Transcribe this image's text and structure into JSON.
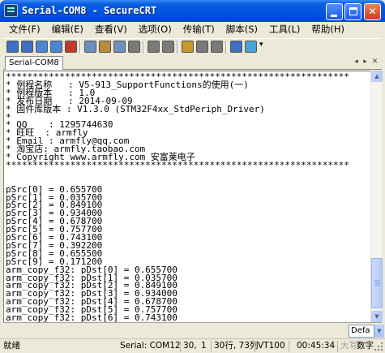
{
  "window": {
    "title": "Serial-COM8 - SecureCRT",
    "minimize_icon": "minimize-icon",
    "maximize_icon": "maximize-icon",
    "close_glyph": "✕"
  },
  "menu": [
    {
      "label": "文件(F)"
    },
    {
      "label": "编辑(E)"
    },
    {
      "label": "查看(V)"
    },
    {
      "label": "选项(O)"
    },
    {
      "label": "传输(T)"
    },
    {
      "label": "脚本(S)"
    },
    {
      "label": "工具(L)"
    },
    {
      "label": "帮助(H)"
    }
  ],
  "toolbar": {
    "buttons": [
      {
        "icon": "connect-icon",
        "color": "#3d6fc4"
      },
      {
        "icon": "quick-connect-icon",
        "color": "#3d6fc4"
      },
      {
        "icon": "connect-tab-icon",
        "color": "#4a86d8"
      },
      {
        "icon": "reconnect-icon",
        "color": "#4a86d8"
      },
      {
        "icon": "disconnect-icon",
        "color": "#c0392b"
      },
      {
        "icon": "copy-icon",
        "color": "#6d8fbf"
      },
      {
        "icon": "paste-icon",
        "color": "#b98d3e"
      },
      {
        "icon": "copy-paste-icon",
        "color": "#6d8fbf"
      },
      {
        "icon": "find-icon",
        "color": "#7a7a7a"
      },
      {
        "icon": "print-icon",
        "color": "#7a7a7a"
      },
      {
        "icon": "print-selection-icon",
        "color": "#7a7a7a"
      },
      {
        "icon": "session-options-icon",
        "color": "#c49a2c"
      },
      {
        "icon": "global-options-icon",
        "color": "#7a7a7a"
      },
      {
        "icon": "keymap-icon",
        "color": "#7a7a7a"
      },
      {
        "icon": "help-icon",
        "color": "#3d6fc4"
      },
      {
        "icon": "sftp-icon",
        "color": "#4aa3d8"
      }
    ],
    "more_glyph": "▾"
  },
  "tabs": [
    {
      "label": "Serial-COM8"
    }
  ],
  "terminal": {
    "lines": [
      "****************************************************************",
      "* 例程名称   : V5-913_SupportFunctions的使用(一)",
      "* 例程版本   : 1.0",
      "* 发布日期   : 2014-09-09",
      "* 固件库版本 : V1.3.0 (STM32F4xx_StdPeriph_Driver)",
      "*",
      "* QQ    : 1295744630",
      "* 旺旺  : armfly",
      "* Email : armfly@qq.com",
      "* 淘宝店: armfly.taobao.com",
      "* Copyright www.armfly.com 安富莱电子",
      "****************************************************************",
      "",
      "",
      "pSrc[0] = 0.655700",
      "pSrc[1] = 0.035700",
      "pSrc[2] = 0.849100",
      "pSrc[3] = 0.934000",
      "pSrc[4] = 0.678700",
      "pSrc[5] = 0.757700",
      "pSrc[6] = 0.743100",
      "pSrc[7] = 0.392200",
      "pSrc[8] = 0.655500",
      "pSrc[9] = 0.171200",
      "arm_copy_f32: pDst[0] = 0.655700",
      "arm_copy_f32: pDst[1] = 0.035700",
      "arm_copy_f32: pDst[2] = 0.849100",
      "arm_copy_f32: pDst[3] = 0.934000",
      "arm_copy_f32: pDst[4] = 0.678700",
      "arm_copy_f32: pDst[5] = 0.757700",
      "arm_copy_f32: pDst[6] = 0.743100"
    ]
  },
  "scrollbar": {
    "up_glyph": "▲",
    "down_glyph": "▼"
  },
  "input_row": {
    "session_value": "Defa",
    "arrow_glyph": "▼"
  },
  "status": {
    "ready": "就绪",
    "session": "Serial: COM12",
    "row": "30,",
    "col": "1",
    "position": "30行, 73列",
    "terminal_type": "VT100",
    "elapsed": "00:45:34",
    "caps": "大写",
    "num": "数字"
  }
}
